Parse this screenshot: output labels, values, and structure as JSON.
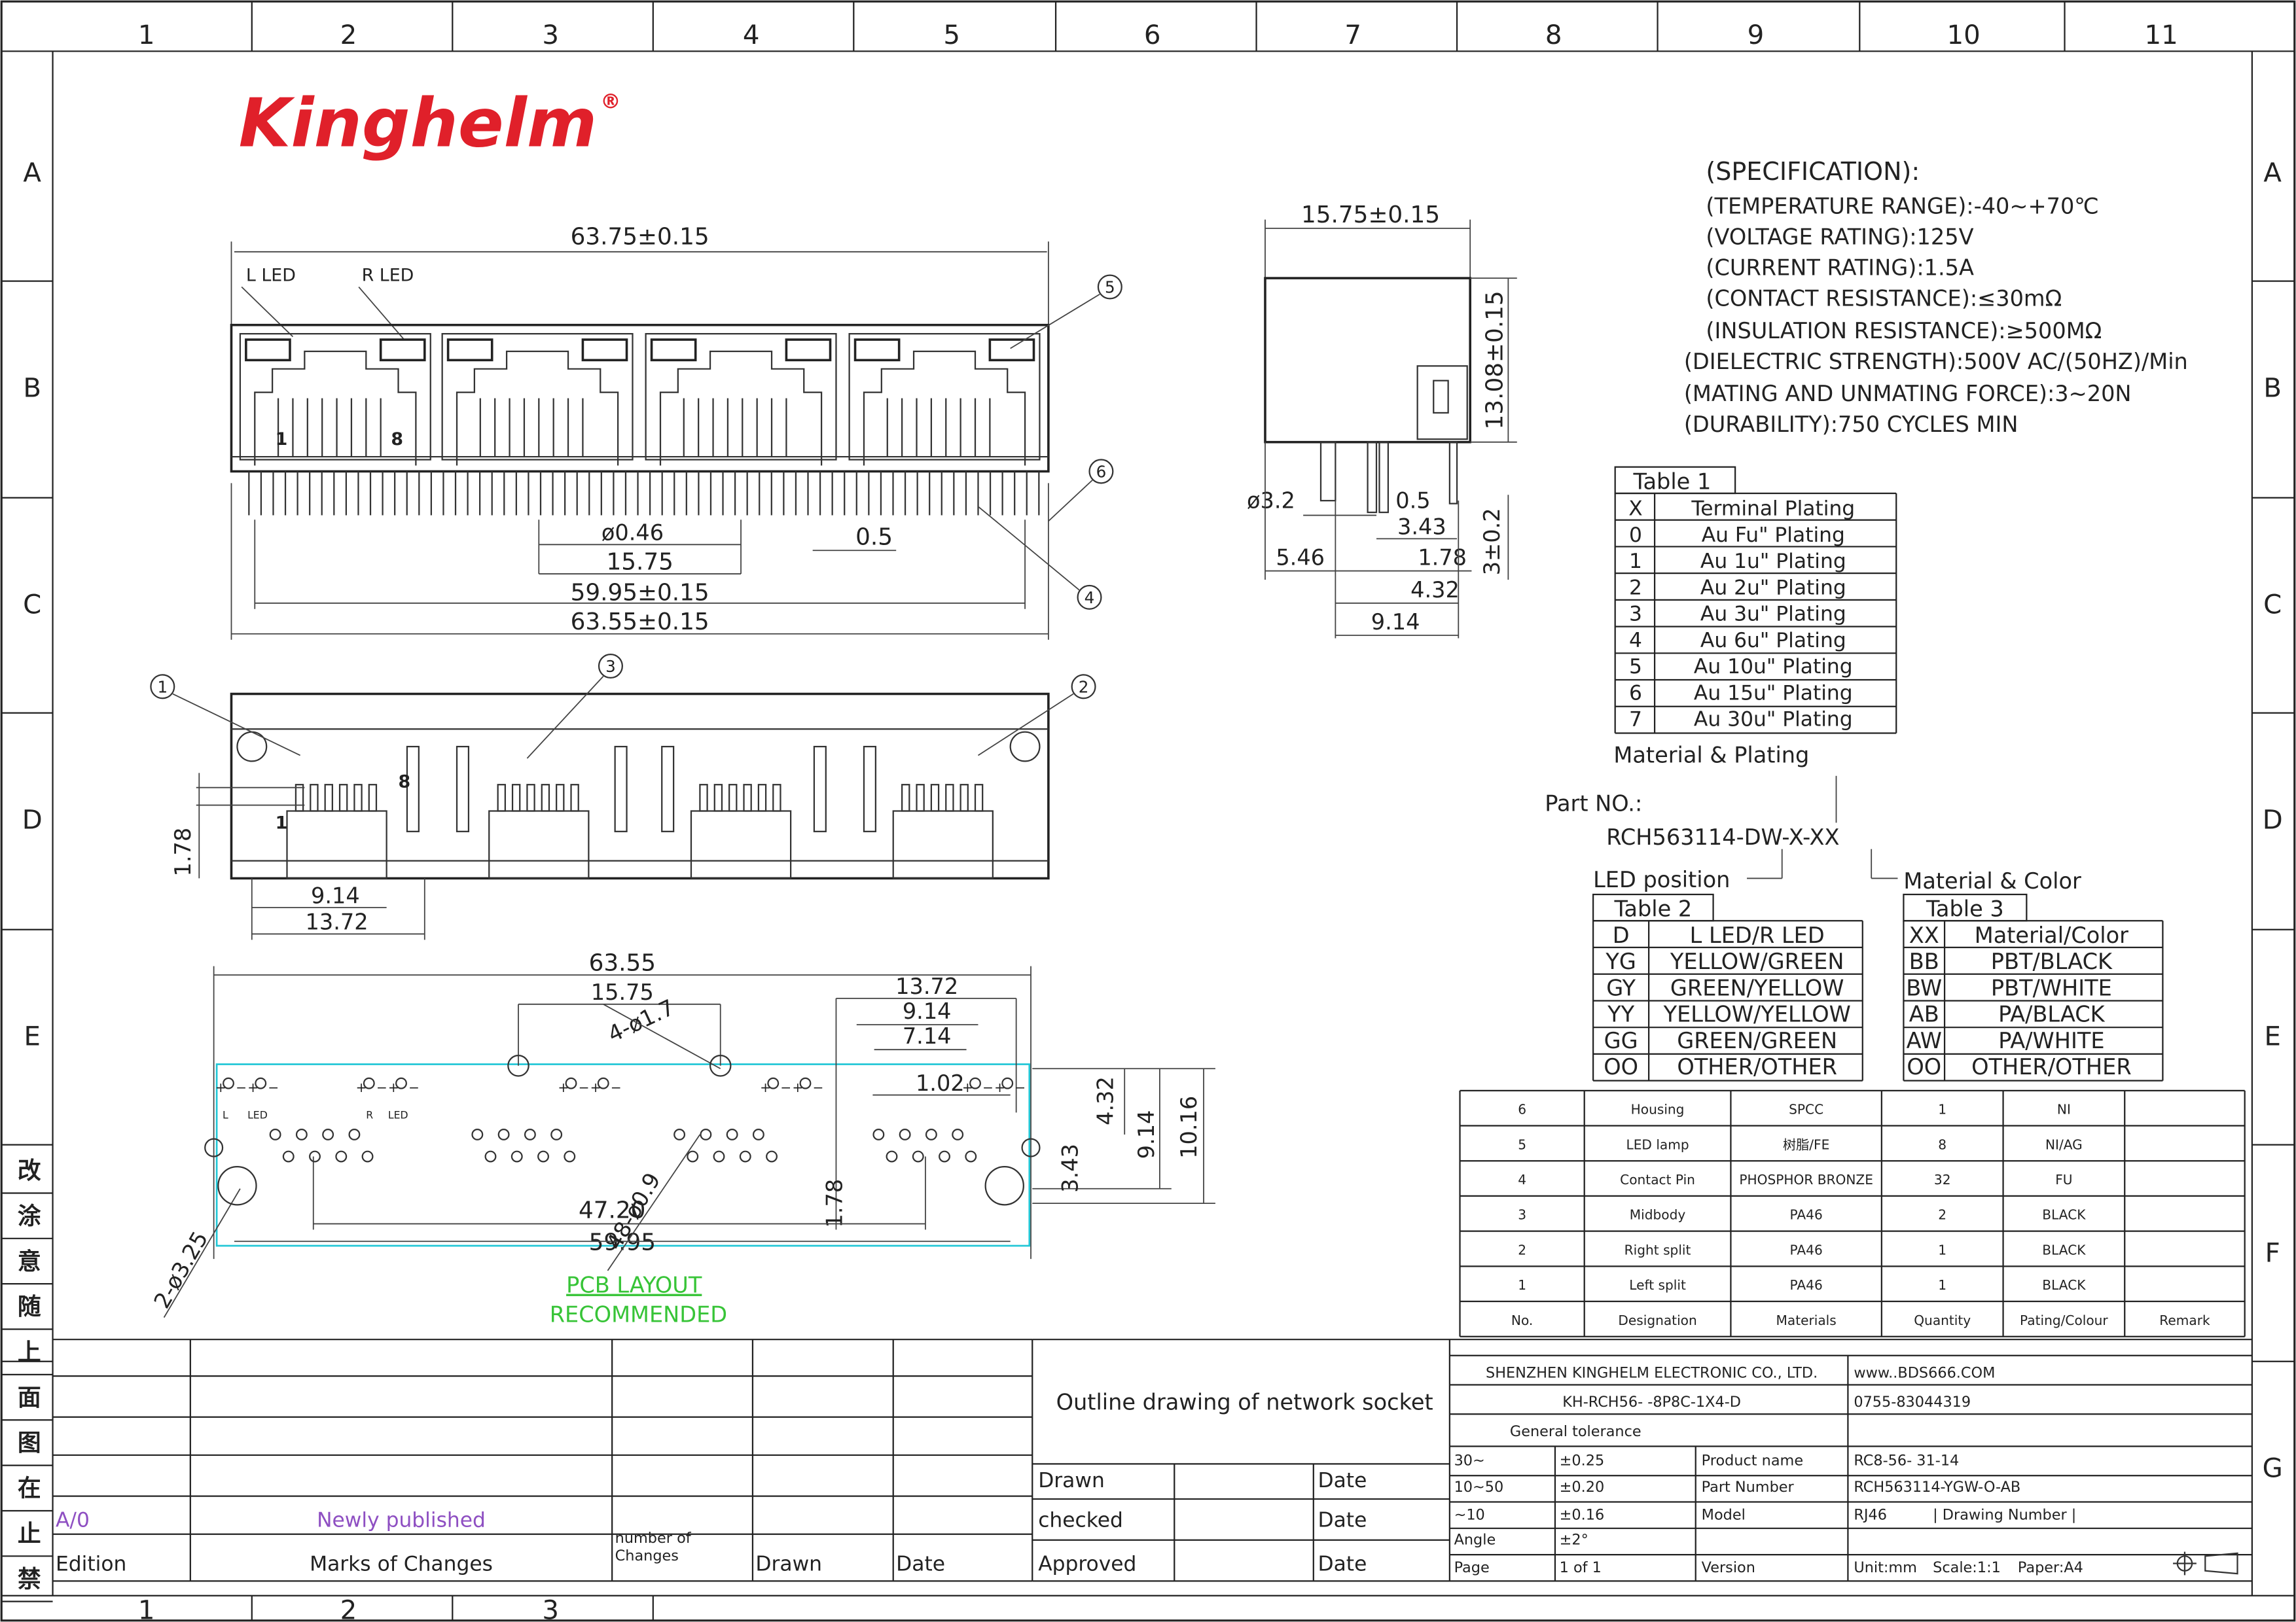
{
  "brand": {
    "logo_text": "Kinghelm",
    "registered_mark": "®",
    "color": "#e0202a"
  },
  "grid": {
    "columns": [
      "1",
      "2",
      "3",
      "4",
      "5",
      "6",
      "7",
      "8",
      "9",
      "10",
      "11"
    ],
    "rows": [
      "A",
      "B",
      "C",
      "D",
      "E",
      "F",
      "G"
    ],
    "side_chars": [
      "改",
      "涂",
      "意",
      "随",
      "上",
      "面",
      "图",
      "在",
      "止",
      "禁"
    ]
  },
  "front_view": {
    "overall_width": "63.75±0.15",
    "l_led": "L LED",
    "r_led": "R LED",
    "pin1": "1",
    "pin8": "8",
    "pin_dia": "ø0.46",
    "pitch_15": "15.75",
    "small_pitch": "0.5",
    "pin_span": "59.95±0.15",
    "bottom_width": "63.55±0.15",
    "callouts": [
      "5",
      "6",
      "4"
    ]
  },
  "side_view": {
    "width": "15.75±0.15",
    "height": "13.08±0.15",
    "peg": "ø3.2",
    "d05": "0.5",
    "d343": "3.43",
    "d546": "5.46",
    "d178": "1.78",
    "d432": "4.32",
    "d914": "9.14",
    "pin_len": "3±0.2"
  },
  "bottom_view": {
    "callouts": [
      "1",
      "3",
      "2"
    ],
    "pin8": "8",
    "pin1": "1",
    "d178": "1.78",
    "d914": "9.14",
    "d1372": "13.72"
  },
  "pcb": {
    "overall": "63.55",
    "d1575": "15.75",
    "led_hole": "4-ø1.7",
    "d1372": "13.72",
    "d914": "9.14",
    "d714": "7.14",
    "d102": "1.02",
    "d432": "4.32",
    "d914v": "9.14",
    "d1016": "10.16",
    "d343": "3.43",
    "d178": "1.78",
    "d4720": "47.20",
    "d5995": "59.95",
    "holes_small": "48-ø0.9",
    "holes_big": "2-ø3.25",
    "l_label": "L",
    "led_label": "LED",
    "r_label": "R",
    "plus": "+",
    "minus": "−",
    "title1": "PCB LAYOUT",
    "title2": "RECOMMENDED"
  },
  "spec": {
    "title": "(SPECIFICATION):",
    "lines": [
      "(TEMPERATURE RANGE):-40~+70℃",
      "(VOLTAGE RATING):125V",
      "(CURRENT RATING):1.5A",
      "(CONTACT RESISTANCE):≤30mΩ",
      "(INSULATION RESISTANCE):≥500MΩ",
      "(DIELECTRIC STRENGTH):500V AC/(50HZ)/Min",
      "(MATING AND UNMATING FORCE):3~20N",
      "(DURABILITY):750 CYCLES MIN"
    ]
  },
  "table1": {
    "title": "Table 1",
    "header": [
      "X",
      "Terminal Plating"
    ],
    "rows": [
      [
        "0",
        "Au Fu\" Plating"
      ],
      [
        "1",
        "Au 1u\" Plating"
      ],
      [
        "2",
        "Au 2u\" Plating"
      ],
      [
        "3",
        "Au 3u\" Plating"
      ],
      [
        "4",
        "Au 6u\" Plating"
      ],
      [
        "5",
        "Au 10u\" Plating"
      ],
      [
        "6",
        "Au 15u\" Plating"
      ],
      [
        "7",
        "Au 30u\" Plating"
      ]
    ],
    "caption": "Material & Plating"
  },
  "part_no": {
    "label": "Part NO.:",
    "value": "RCH563114-DW-X-XX",
    "led_position": "LED position",
    "material_color": "Material & Color"
  },
  "table2": {
    "title": "Table 2",
    "header": [
      "D",
      "L LED/R LED"
    ],
    "rows": [
      [
        "YG",
        "YELLOW/GREEN"
      ],
      [
        "GY",
        "GREEN/YELLOW"
      ],
      [
        "YY",
        "YELLOW/YELLOW"
      ],
      [
        "GG",
        "GREEN/GREEN"
      ],
      [
        "OO",
        "OTHER/OTHER"
      ]
    ]
  },
  "table3": {
    "title": "Table 3",
    "header": [
      "XX",
      "Material/Color"
    ],
    "rows": [
      [
        "BB",
        "PBT/BLACK"
      ],
      [
        "BW",
        "PBT/WHITE"
      ],
      [
        "AB",
        "PA/BLACK"
      ],
      [
        "AW",
        "PA/WHITE"
      ],
      [
        "OO",
        "OTHER/OTHER"
      ]
    ]
  },
  "bom": {
    "rows": [
      [
        "6",
        "Housing",
        "SPCC",
        "1",
        "NI",
        ""
      ],
      [
        "5",
        "LED lamp",
        "树脂/FE",
        "8",
        "NI/AG",
        ""
      ],
      [
        "4",
        "Contact Pin",
        "PHOSPHOR BRONZE",
        "32",
        "FU",
        ""
      ],
      [
        "3",
        "Midbody",
        "PA46",
        "2",
        "BLACK",
        ""
      ],
      [
        "2",
        "Right split",
        "PA46",
        "1",
        "BLACK",
        ""
      ],
      [
        "1",
        "Left split",
        "PA46",
        "1",
        "BLACK",
        ""
      ]
    ],
    "header": [
      "No.",
      "Designation",
      "Materials",
      "Quantity",
      "Pating/Colour",
      "Remark"
    ]
  },
  "revision": {
    "edition": "A/0",
    "change": "Newly published",
    "edition_label": "Edition",
    "marks_label": "Marks of Changes",
    "number_label": "number of Changes",
    "drawn_label": "Drawn",
    "date_label": "Date"
  },
  "title_block": {
    "title": "Outline drawing of network socket",
    "drawn": "Drawn",
    "checked": "checked",
    "approved": "Approved",
    "date": "Date",
    "company": "SHENZHEN KINGHELM ELECTRONIC CO., LTD.",
    "website": "www..BDS666.COM",
    "code": "KH-RCH56- -8P8C-1X4-D",
    "phone": "0755-83044319",
    "general_tolerance": "General tolerance",
    "tol_rows": [
      [
        "30~",
        "±0.25"
      ],
      [
        "10~50",
        "±0.20"
      ],
      [
        "~10",
        "±0.16"
      ],
      [
        "Angle",
        "±2°"
      ],
      [
        "Page",
        "1 of 1"
      ]
    ],
    "product_name_label": "Product name",
    "product_name": "RC8-56- 31-14",
    "part_number_label": "Part Number",
    "part_number": "RCH563114-YGW-O-AB",
    "model_label": "Model",
    "model": "RJ46",
    "drawing_number": "| Drawing Number |",
    "version_label": "Version",
    "unit": "Unit:mm",
    "scale": "Scale:1:1",
    "paper": "Paper:A4"
  }
}
